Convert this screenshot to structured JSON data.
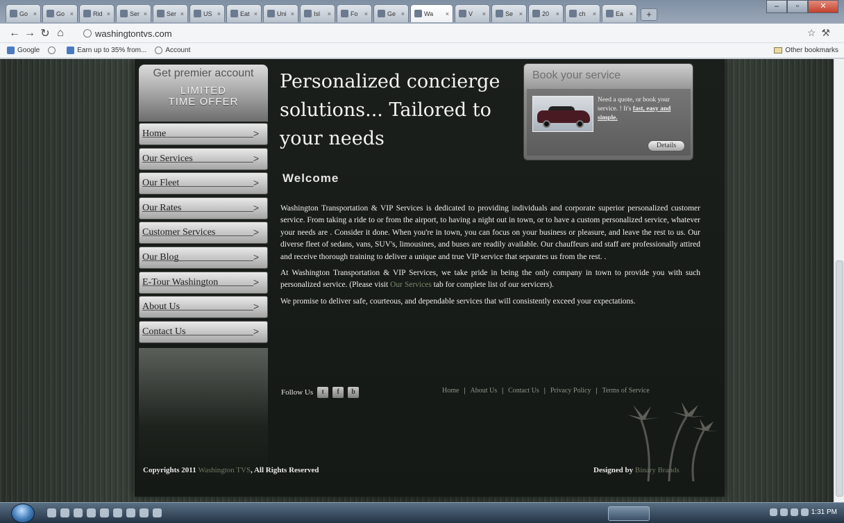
{
  "browser": {
    "tabs": [
      {
        "title": "Go",
        "active": false
      },
      {
        "title": "Go",
        "active": false
      },
      {
        "title": "Rid",
        "active": false
      },
      {
        "title": "Ser",
        "active": false
      },
      {
        "title": "Ser",
        "active": false
      },
      {
        "title": "US",
        "active": false
      },
      {
        "title": "Eat",
        "active": false
      },
      {
        "title": "Uni",
        "active": false
      },
      {
        "title": "Isl",
        "active": false
      },
      {
        "title": "Fo",
        "active": false
      },
      {
        "title": "Ge",
        "active": false
      },
      {
        "title": "Wa",
        "active": true
      },
      {
        "title": "V",
        "active": false
      },
      {
        "title": "Se",
        "active": false
      },
      {
        "title": "20",
        "active": false
      },
      {
        "title": "ch",
        "active": false
      },
      {
        "title": "Ea",
        "active": false
      }
    ],
    "new_tab": "+",
    "url": "washingtontvs.com",
    "bookmarks": [
      "Google",
      "Earn up to 35% from...",
      "Account"
    ],
    "other_bookmarks": "Other bookmarks"
  },
  "site": {
    "promo": {
      "line1": "Get premier account",
      "line2": "LIMITED",
      "line3": "TIME OFFER"
    },
    "nav": [
      "Home",
      "Our Services",
      "Our Fleet",
      "Our Rates",
      "Customer Services",
      "Our Blog",
      "E-Tour Washington",
      "About Us",
      "Contact Us"
    ],
    "headline": "Personalized concierge solutions... Tailored to your needs",
    "welcome": "Welcome",
    "book": {
      "title": "Book your service",
      "text": "Need a quote, or book your service. ! It's",
      "highlight": "fast, easy and simple.",
      "details": "Details"
    },
    "para1": "Washington Transportation & VIP Services is dedicated to providing individuals and corporate superior personalized customer service. From taking a ride to or from the airport, to having a night out in town, or to have a custom personalized service, whatever your needs are . Consider it done. When you're in town, you can focus on your business or pleasure, and leave the rest to us. Our diverse fleet of sedans, vans, SUV's, limousines, and buses are readily available. Our chauffeurs and staff are professionally attired and receive thorough training to deliver a unique and true VIP service that separates us from the rest. .",
    "para2_before": "At Washington Transportation & VIP Services, we take pride in being the only company in town to provide you with such personalized service. (Please visit",
    "para2_link": "Our Services",
    "para2_after": "tab for complete list of our servicers).",
    "para3": "We promise to deliver safe, courteous, and dependable services that will consistently exceed your expectations.",
    "follow": "Follow Us",
    "footer_links": [
      "Home",
      "About Us",
      "Contact Us",
      "Privacy Policy",
      "Terms of Service"
    ],
    "copyright_prefix": "Copyrights 2011",
    "copyright_link": "Washington TVS",
    "copyright_suffix": ", All Rights Reserved",
    "designed_prefix": "Designed by",
    "designed_link": "Binary Brands"
  },
  "taskbar": {
    "time": "1:31 PM"
  }
}
